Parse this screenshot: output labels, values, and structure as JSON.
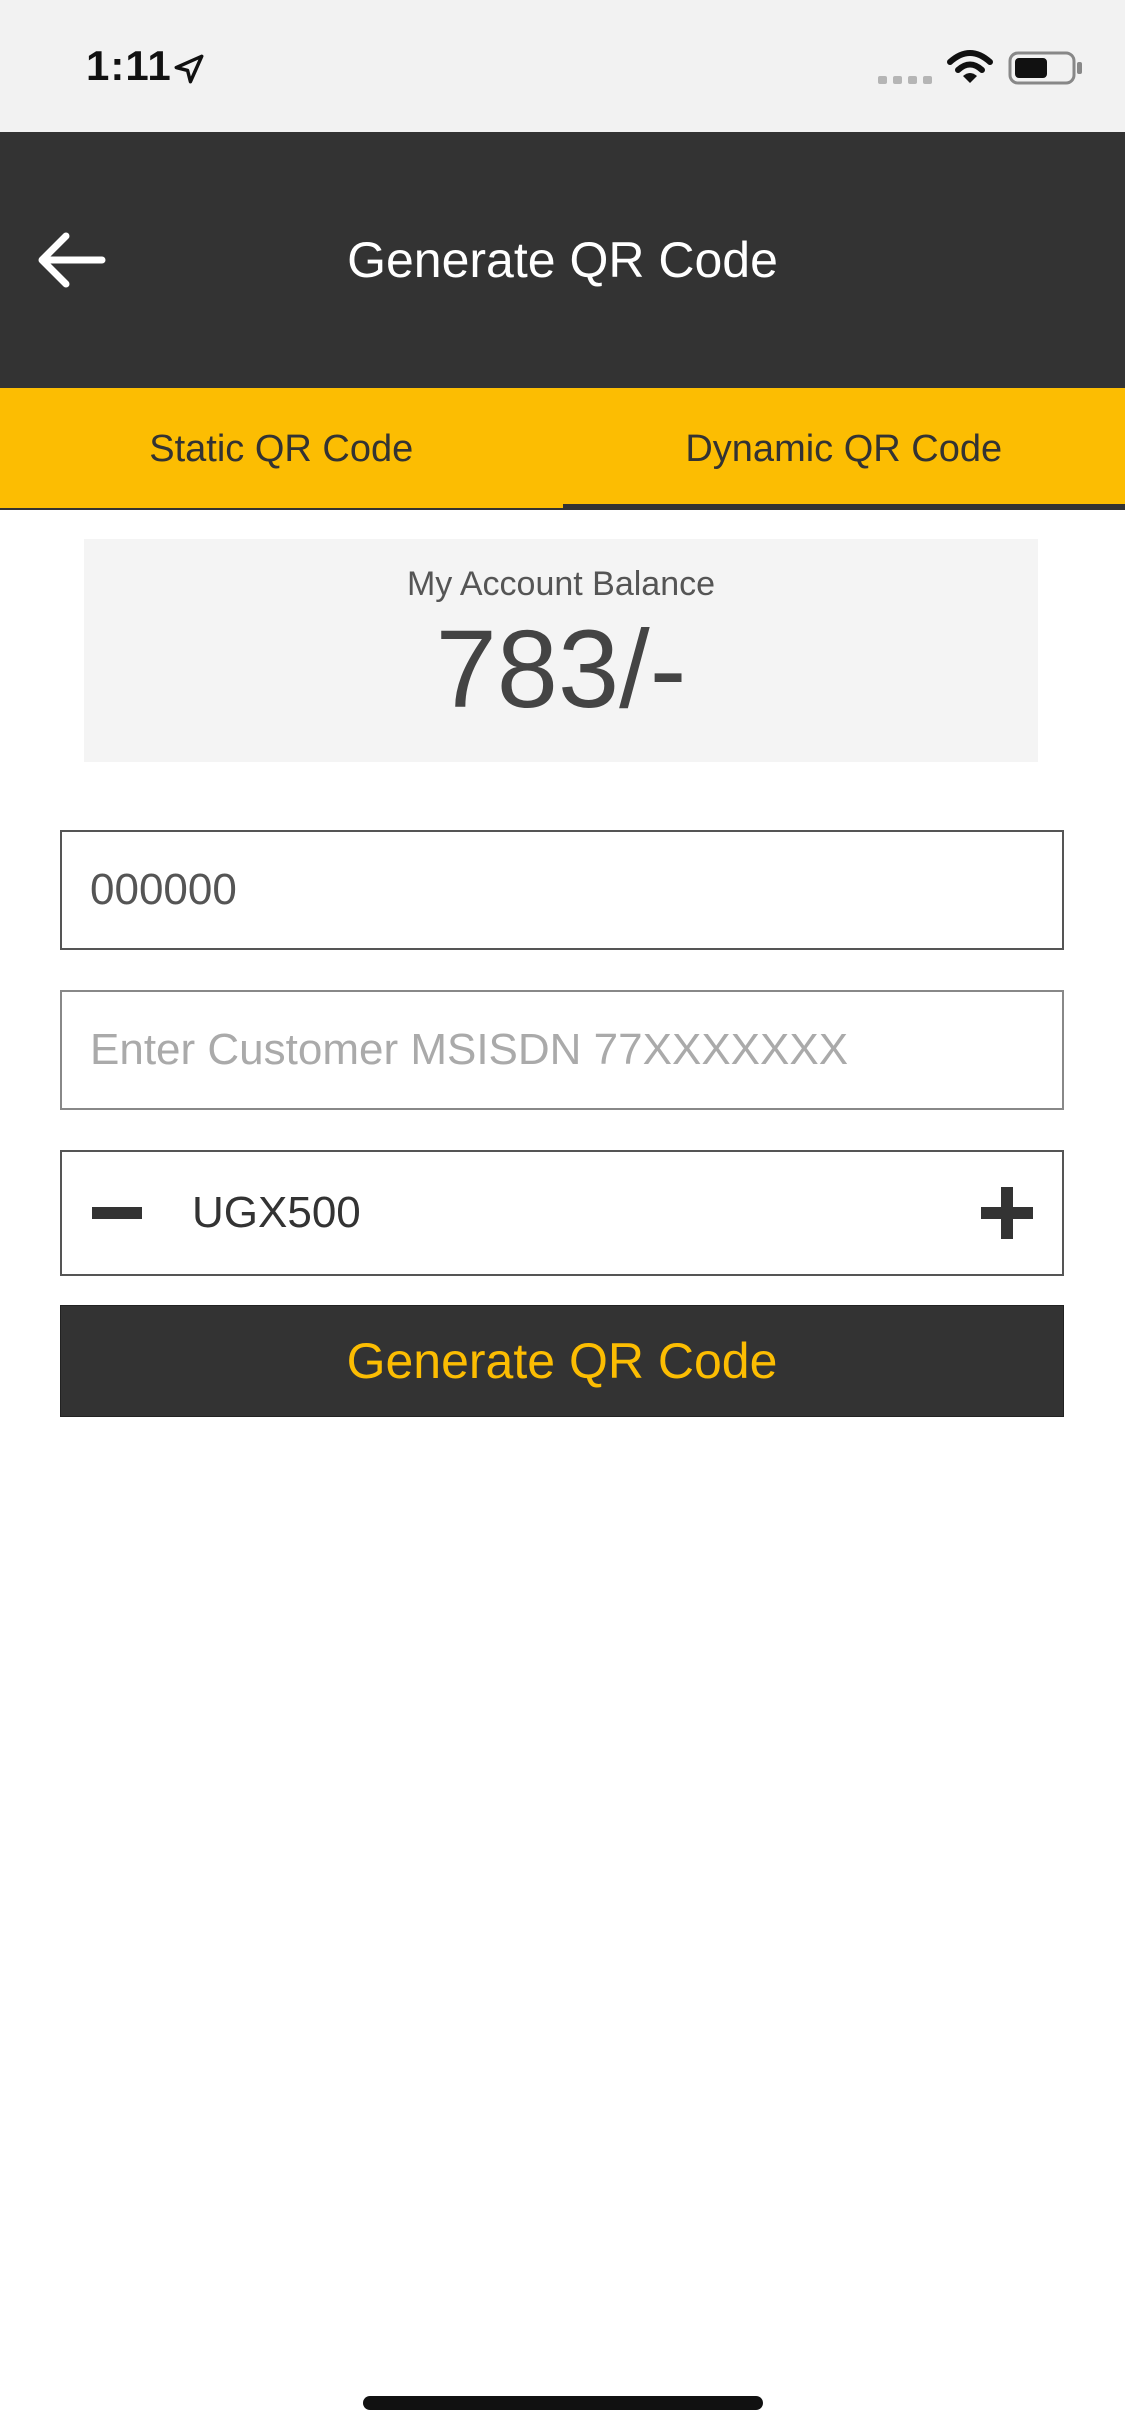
{
  "status_bar": {
    "time": "1:11",
    "icons": [
      "location-arrow-icon",
      "signal-icon",
      "wifi-icon",
      "battery-icon"
    ]
  },
  "header": {
    "title": "Generate QR Code",
    "back_icon": "arrow-left-icon"
  },
  "tabs": [
    {
      "label": "Static QR Code",
      "active": false
    },
    {
      "label": "Dynamic QR Code",
      "active": true
    }
  ],
  "balance": {
    "label": "My Account Balance",
    "value": "783/-"
  },
  "form": {
    "code_value": "000000",
    "msisdn_placeholder": "Enter Customer MSISDN 77XXXXXXX",
    "amount_value": "UGX500",
    "generate_label": "Generate QR Code"
  },
  "colors": {
    "accent": "#fcbd02",
    "header_bg": "#333333",
    "status_bg": "#f2f2f2",
    "card_bg": "#f4f4f4"
  }
}
